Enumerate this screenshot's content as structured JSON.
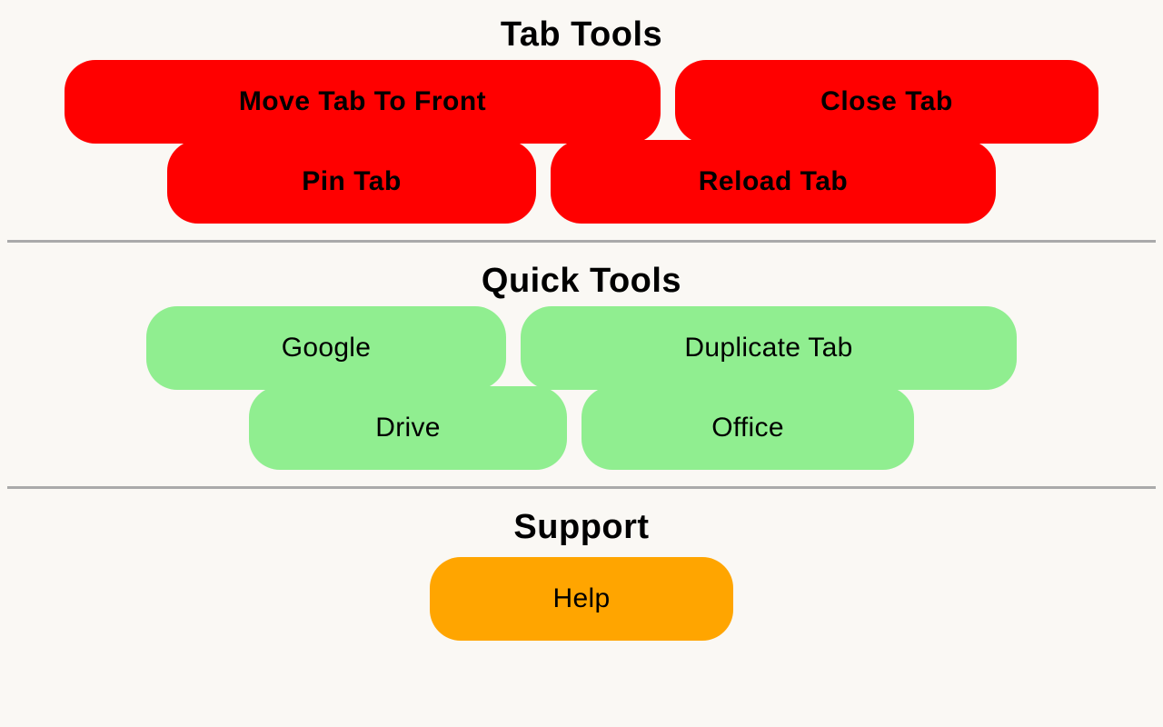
{
  "page": {
    "background_color": "#FAF8F4",
    "text_color": "#000000"
  },
  "sections": [
    {
      "id": "tab-tools",
      "title": "Tab Tools",
      "accent_color": "#FF0000",
      "rows": [
        [
          {
            "label": "Move Tab To Front"
          },
          {
            "label": "Close Tab"
          }
        ],
        [
          {
            "label": "Pin Tab"
          },
          {
            "label": "Reload Tab"
          }
        ]
      ]
    },
    {
      "id": "quick-tools",
      "title": "Quick Tools",
      "accent_color": "#90EE90",
      "rows": [
        [
          {
            "label": "Google"
          },
          {
            "label": "Duplicate Tab"
          }
        ],
        [
          {
            "label": "Drive"
          },
          {
            "label": "Office"
          }
        ]
      ]
    },
    {
      "id": "support",
      "title": "Support",
      "accent_color": "#FFA500",
      "rows": [
        [
          {
            "label": "Help"
          }
        ]
      ]
    }
  ],
  "divider_color": "#AAAAAA"
}
